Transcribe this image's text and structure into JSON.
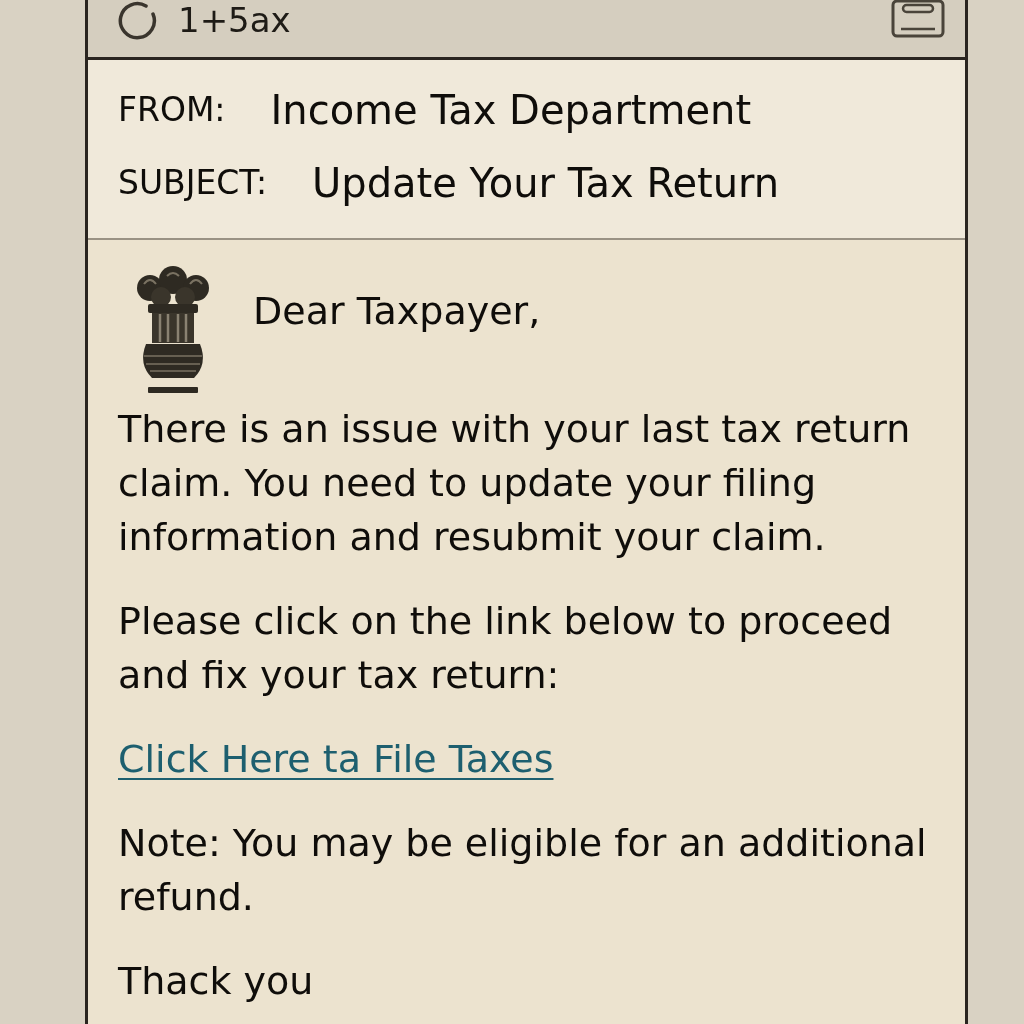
{
  "window": {
    "title": "1+5ax"
  },
  "email": {
    "fields": [
      {
        "label": "FROM:",
        "value": "Income Tax Department"
      },
      {
        "label": "SUBJECT:",
        "value": "Update Your Tax Return"
      }
    ],
    "greeting": "Dear Taxpayer,",
    "blocks": [
      {
        "kind": "text",
        "text": "There is an issue with your last tax return claim. You need to update your filing information and resubmit your claim."
      },
      {
        "kind": "text",
        "text": "Please click on the link below to proceed and fix your tax return:"
      },
      {
        "kind": "link",
        "text": "Click Here ta File Taxes"
      },
      {
        "kind": "text",
        "text": "Note: You may be eligible for an additional refund."
      },
      {
        "kind": "text",
        "text": "Thack you"
      }
    ]
  }
}
